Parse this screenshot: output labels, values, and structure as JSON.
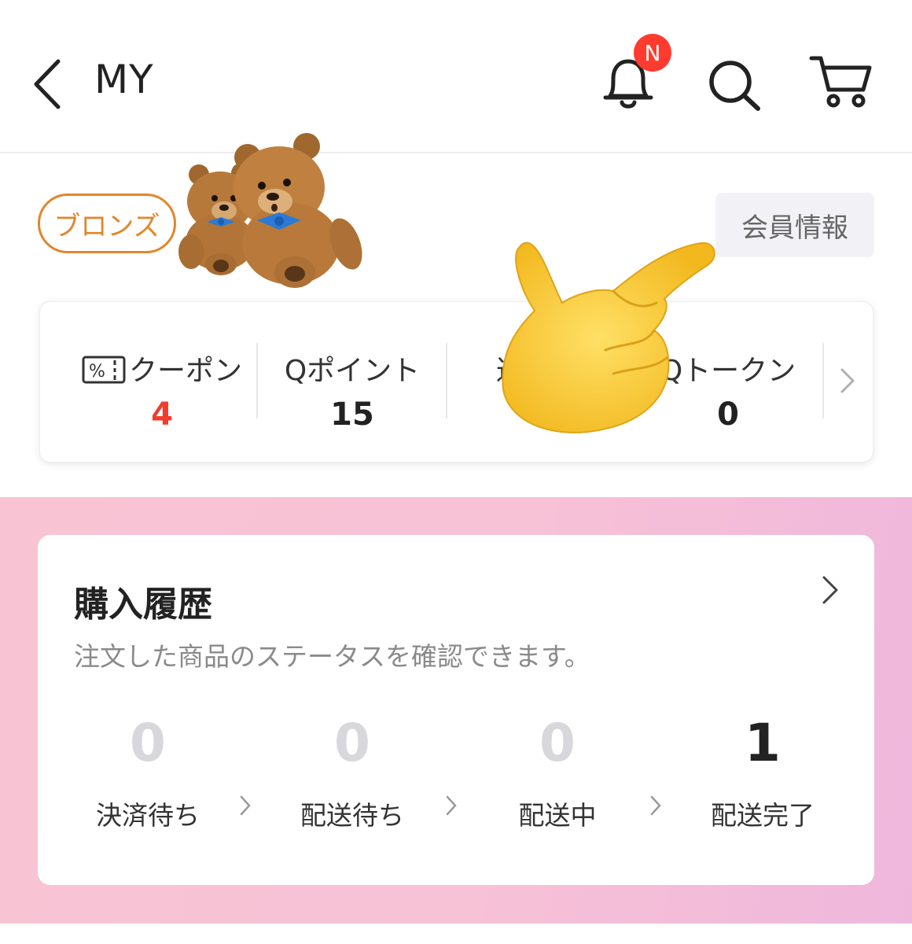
{
  "header": {
    "title": "MY",
    "notification_badge": "N"
  },
  "profile": {
    "grade": "ブロンズ",
    "member_info_button": "会員情報"
  },
  "points": [
    {
      "label": "クーポン",
      "value": "4",
      "highlight": true
    },
    {
      "label": "Qポイント",
      "value": "15",
      "highlight": false
    },
    {
      "label": "返",
      "value": "",
      "highlight": false
    },
    {
      "label": "Qトークン",
      "value": "0",
      "highlight": false
    }
  ],
  "history": {
    "title": "購入履歴",
    "subtitle": "注文した商品のステータスを確認できます。",
    "statuses": [
      {
        "count": "0",
        "label": "決済待ち"
      },
      {
        "count": "0",
        "label": "配送待ち"
      },
      {
        "count": "0",
        "label": "配送中"
      },
      {
        "count": "1",
        "label": "配送完了"
      }
    ]
  },
  "colors": {
    "accent_red": "#f03c2e",
    "bronze": "#e0872b",
    "pink_bg": "#f8c4d4"
  },
  "icons": [
    "back-arrow-icon",
    "bell-icon",
    "search-icon",
    "cart-icon",
    "coupon-icon",
    "chevron-right-icon",
    "teddy-bear-sticker",
    "pointing-hand-sticker"
  ]
}
